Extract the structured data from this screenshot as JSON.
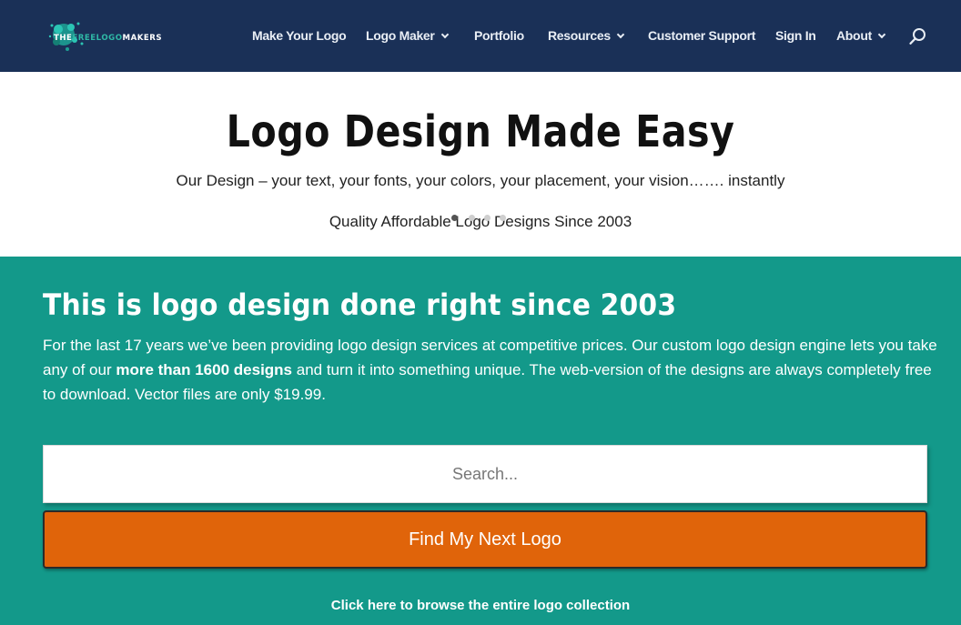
{
  "header": {
    "logo": {
      "prefix": "THE",
      "highlight": "FREELOGO",
      "suffix": "MAKERS"
    },
    "nav": [
      {
        "label": "Make Your Logo",
        "has_dropdown": false
      },
      {
        "label": "Logo Maker",
        "has_dropdown": true
      },
      {
        "label": "Portfolio",
        "has_dropdown": false
      },
      {
        "label": "Resources",
        "has_dropdown": true
      },
      {
        "label": "Customer Support",
        "has_dropdown": false
      },
      {
        "label": "Sign In",
        "has_dropdown": false
      },
      {
        "label": "About",
        "has_dropdown": true
      }
    ],
    "search_icon": "search-icon"
  },
  "hero": {
    "title": "Logo Design Made Easy",
    "subtitle": "Our Design – your text, your fonts, your colors, your placement, your vision……. instantly",
    "tagline": "Quality Affordable Logo Designs Since 2003",
    "slider_dots": 4,
    "active_dot": 0
  },
  "intro": {
    "title": "This is logo design done right since 2003",
    "body_part1": "For the last 17 years we’ve been providing logo design services at competitive prices. Our custom logo design engine lets you take any of our ",
    "body_bold": "more than 1600 designs",
    "body_part2": " and turn it into something unique. The web-version of the designs are always completely free to download. Vector files are only $19.99."
  },
  "search": {
    "placeholder": "Search...",
    "button_label": "Find My Next Logo"
  },
  "browse_link": "Click here to browse the entire logo collection",
  "colors": {
    "header_bg": "#1a3057",
    "teal_bg": "#13998a",
    "cta_orange": "#e0640a",
    "logo_accent": "#2fb8a6"
  }
}
